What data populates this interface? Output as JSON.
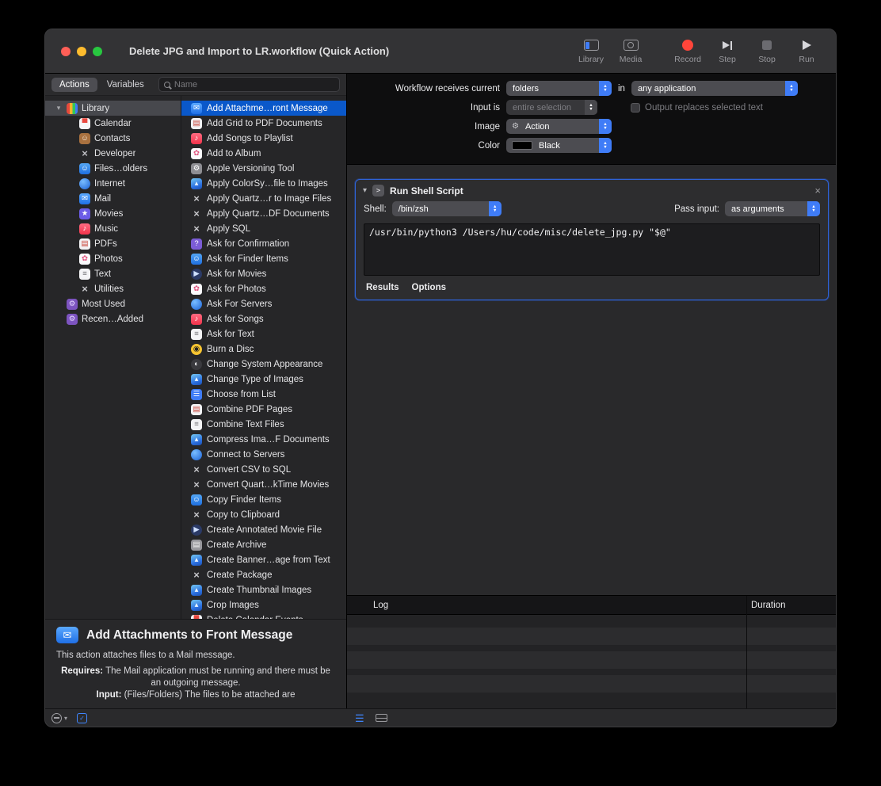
{
  "window": {
    "title": "Delete JPG and Import to LR.workflow (Quick Action)"
  },
  "glyphs": {
    "chevron_down": "▾",
    "chevron_right": "▸",
    "close": "×",
    "check": "✓"
  },
  "colors": {
    "accent_blue": "#3f7cf7",
    "selection_blue": "#0a58ca",
    "color_swatch": "#000000"
  },
  "toolbar": {
    "items": [
      {
        "label": "Library",
        "icon": "library-toolbar-icon"
      },
      {
        "label": "Media",
        "icon": "media-toolbar-icon"
      },
      {
        "label": "Record",
        "icon": "record-icon",
        "gap": true
      },
      {
        "label": "Step",
        "icon": "step-icon"
      },
      {
        "label": "Stop",
        "icon": "stop-icon"
      },
      {
        "label": "Run",
        "icon": "run-icon"
      }
    ]
  },
  "library_bar": {
    "actions_tab": "Actions",
    "variables_tab": "Variables",
    "search_placeholder": "Name"
  },
  "sidebar": {
    "items": [
      {
        "label": "Library",
        "icon": "library",
        "indent": 0,
        "selected": true,
        "expanded": true
      },
      {
        "label": "Calendar",
        "icon": "calendar",
        "indent": 1
      },
      {
        "label": "Contacts",
        "icon": "contacts",
        "indent": 1
      },
      {
        "label": "Developer",
        "icon": "developer",
        "indent": 1
      },
      {
        "label": "Files…olders",
        "icon": "finder",
        "indent": 1
      },
      {
        "label": "Internet",
        "icon": "internet",
        "indent": 1
      },
      {
        "label": "Mail",
        "icon": "mail",
        "indent": 1
      },
      {
        "label": "Movies",
        "icon": "movies-folder",
        "indent": 1
      },
      {
        "label": "Music",
        "icon": "music",
        "indent": 1
      },
      {
        "label": "PDFs",
        "icon": "pdf",
        "indent": 1
      },
      {
        "label": "Photos",
        "icon": "photos",
        "indent": 1
      },
      {
        "label": "Text",
        "icon": "text",
        "indent": 1
      },
      {
        "label": "Utilities",
        "icon": "utility-x",
        "indent": 1
      },
      {
        "label": "Most Used",
        "icon": "smart-folder",
        "indent": 0
      },
      {
        "label": "Recen…Added",
        "icon": "smart-folder",
        "indent": 0
      }
    ]
  },
  "actions_list": {
    "items": [
      {
        "label": "Add Attachme…ront Message",
        "icon": "mail",
        "selected": true
      },
      {
        "label": "Add Grid to PDF Documents",
        "icon": "pdf"
      },
      {
        "label": "Add Songs to Playlist",
        "icon": "music"
      },
      {
        "label": "Add to Album",
        "icon": "photos"
      },
      {
        "label": "Apple Versioning Tool",
        "icon": "tool"
      },
      {
        "label": "Apply ColorSy…file to Images",
        "icon": "image"
      },
      {
        "label": "Apply Quartz…r to Image Files",
        "icon": "utility-x"
      },
      {
        "label": "Apply Quartz…DF Documents",
        "icon": "utility-x"
      },
      {
        "label": "Apply SQL",
        "icon": "utility-x"
      },
      {
        "label": "Ask for Confirmation",
        "icon": "confirmation"
      },
      {
        "label": "Ask for Finder Items",
        "icon": "finder"
      },
      {
        "label": "Ask for Movies",
        "icon": "movies"
      },
      {
        "label": "Ask for Photos",
        "icon": "photos"
      },
      {
        "label": "Ask For Servers",
        "icon": "servers"
      },
      {
        "label": "Ask for Songs",
        "icon": "music"
      },
      {
        "label": "Ask for Text",
        "icon": "text"
      },
      {
        "label": "Burn a Disc",
        "icon": "burn"
      },
      {
        "label": "Change System Appearance",
        "icon": "appearance"
      },
      {
        "label": "Change Type of Images",
        "icon": "image"
      },
      {
        "label": "Choose from List",
        "icon": "list"
      },
      {
        "label": "Combine PDF Pages",
        "icon": "pdf"
      },
      {
        "label": "Combine Text Files",
        "icon": "text"
      },
      {
        "label": "Compress Ima…F Documents",
        "icon": "image"
      },
      {
        "label": "Connect to Servers",
        "icon": "servers"
      },
      {
        "label": "Convert CSV to SQL",
        "icon": "utility-x"
      },
      {
        "label": "Convert Quart…kTime Movies",
        "icon": "utility-x"
      },
      {
        "label": "Copy Finder Items",
        "icon": "finder"
      },
      {
        "label": "Copy to Clipboard",
        "icon": "utility-x"
      },
      {
        "label": "Create Annotated Movie File",
        "icon": "movies"
      },
      {
        "label": "Create Archive",
        "icon": "archive"
      },
      {
        "label": "Create Banner…age from Text",
        "icon": "image"
      },
      {
        "label": "Create Package",
        "icon": "utility-x"
      },
      {
        "label": "Create Thumbnail Images",
        "icon": "image"
      },
      {
        "label": "Crop Images",
        "icon": "image"
      },
      {
        "label": "Delete Calendar Events",
        "icon": "calendar",
        "partial": true
      }
    ]
  },
  "description": {
    "title": "Add Attachments to Front Message",
    "summary": "This action attaches files to a Mail message.",
    "requires_label": "Requires:",
    "requires_text": "The Mail application must be running and there must be an outgoing message.",
    "input_label": "Input:",
    "input_text": "(Files/Folders) The files to be attached are"
  },
  "config": {
    "receives_label": "Workflow receives current",
    "receives_value": "folders",
    "in_label": "in",
    "application_value": "any application",
    "input_is_label": "Input is",
    "input_is_value": "entire selection",
    "output_checkbox_label": "Output replaces selected text",
    "image_label": "Image",
    "image_value": "Action",
    "color_label": "Color",
    "color_value": "Black"
  },
  "shell_action": {
    "title": "Run Shell Script",
    "shell_label": "Shell:",
    "shell_value": "/bin/zsh",
    "pass_input_label": "Pass input:",
    "pass_input_value": "as arguments",
    "code": "/usr/bin/python3 /Users/hu/code/misc/delete_jpg.py \"$@\"",
    "tabs": [
      "Results",
      "Options"
    ]
  },
  "log": {
    "log_header": "Log",
    "duration_header": "Duration"
  },
  "icon_styles": {
    "library": {
      "bg": "linear-gradient(90deg,#e5493d 0 30%,#f7b32b 30% 55%,#34c759 55% 78%,#3f7cf7 78% 100%)",
      "glyph": "",
      "fg": "#fff"
    },
    "calendar": {
      "bg": "#f5f5f7",
      "glyph": "▀",
      "fg": "#e8483f"
    },
    "contacts": {
      "bg": "#a9713f",
      "glyph": "☺",
      "fg": "#f5e8d7"
    },
    "developer": {
      "bg": "none",
      "glyph": "×",
      "fg": "#bfbfc4",
      "bold": true
    },
    "finder": {
      "bg": "linear-gradient(180deg,#53a6f3,#1f6fe0)",
      "glyph": "☺",
      "fg": "#fff"
    },
    "internet": {
      "bg": "radial-gradient(circle at 35% 30%,#79bdff,#1b62d6)",
      "glyph": "",
      "fg": "#fff",
      "round": true
    },
    "servers": {
      "bg": "radial-gradient(circle at 35% 30%,#79bdff,#1b62d6)",
      "glyph": "",
      "fg": "#fff",
      "round": true
    },
    "mail": {
      "bg": "linear-gradient(180deg,#5aa9ff,#1f6fe6)",
      "glyph": "✉",
      "fg": "#fff"
    },
    "movies-folder": {
      "bg": "#6c5ce7",
      "glyph": "★",
      "fg": "#fff"
    },
    "movies": {
      "bg": "#2b3a66",
      "glyph": "▶",
      "fg": "#cfe0ff",
      "round": true
    },
    "music": {
      "bg": "linear-gradient(180deg,#ff6b81,#f2334b)",
      "glyph": "♪",
      "fg": "#fff"
    },
    "pdf": {
      "bg": "#f2f2f4",
      "glyph": "▤",
      "fg": "#c94438"
    },
    "photos": {
      "bg": "#fbfbfd",
      "glyph": "✿",
      "fg": "#e0557f"
    },
    "text": {
      "bg": "#f4f4f6",
      "glyph": "≡",
      "fg": "#7a7a7e"
    },
    "utility-x": {
      "bg": "none",
      "glyph": "×",
      "fg": "#c6c6ca",
      "bold": true
    },
    "smart-folder": {
      "bg": "#7d54c0",
      "glyph": "⚙",
      "fg": "#e7d9ff"
    },
    "tool": {
      "bg": "#8e8e93",
      "glyph": "⚙",
      "fg": "#fff"
    },
    "image": {
      "bg": "linear-gradient(160deg,#74c7f0,#2b6fe0 65%,#1c4fae)",
      "glyph": "▴",
      "fg": "#eaf6ff"
    },
    "confirmation": {
      "bg": "#7b5cd6",
      "glyph": "?",
      "fg": "#fff"
    },
    "burn": {
      "bg": "#f7c531",
      "glyph": "◉",
      "fg": "#222",
      "round": true
    },
    "appearance": {
      "bg": "#3a3a3e",
      "glyph": "◐",
      "fg": "#f0f0f2",
      "round": true
    },
    "list": {
      "bg": "#3f7cf7",
      "glyph": "☰",
      "fg": "#fff"
    },
    "archive": {
      "bg": "#98989d",
      "glyph": "▤",
      "fg": "#f2f2f2"
    },
    "shell-script": {
      "bg": "#55555a",
      "glyph": ">",
      "fg": "#e8e8ec"
    }
  }
}
